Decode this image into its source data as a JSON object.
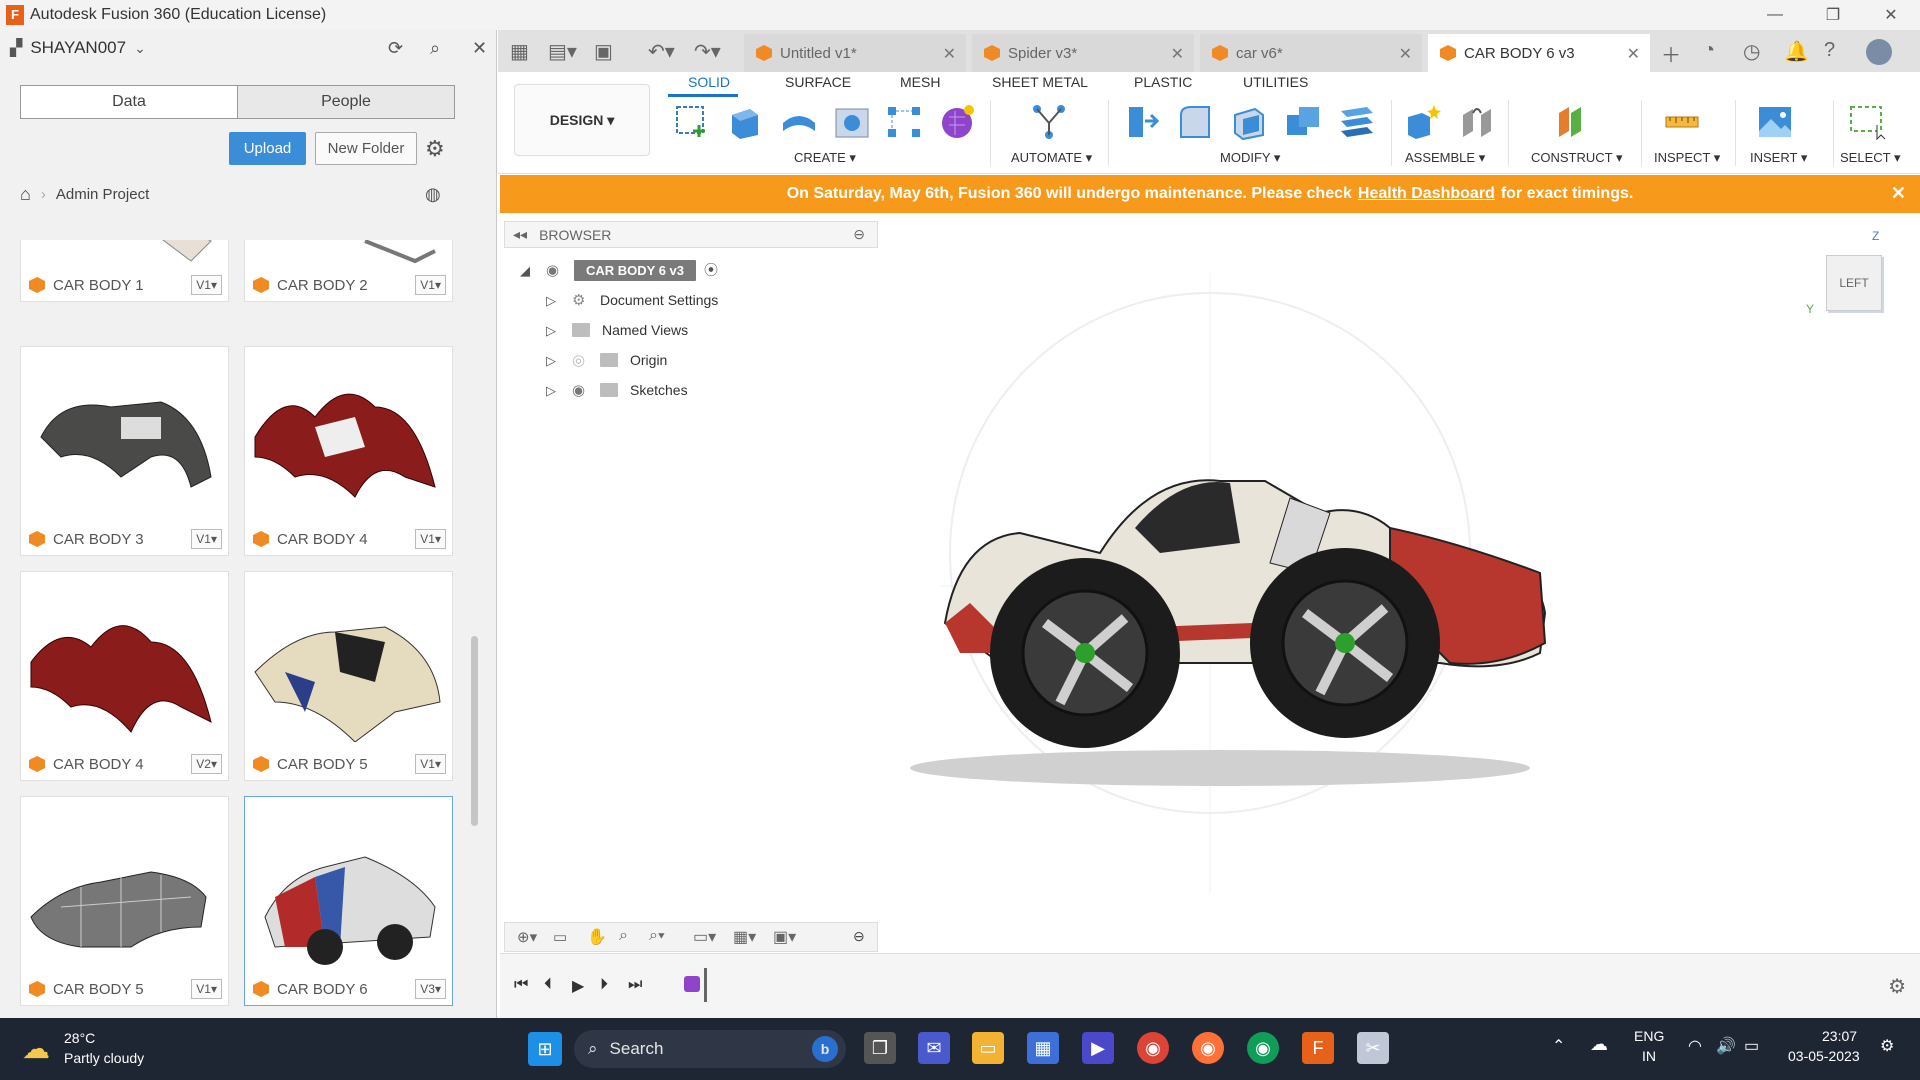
{
  "window": {
    "title": "Autodesk Fusion 360 (Education License)",
    "app_icon": "F"
  },
  "left_panel": {
    "user": "SHAYAN007",
    "tabs": [
      "Data",
      "People"
    ],
    "upload_label": "Upload",
    "new_folder_label": "New Folder",
    "breadcrumb": "Admin Project",
    "cards": [
      {
        "name": "CAR BODY 1",
        "version": "V1▾"
      },
      {
        "name": "CAR BODY 2",
        "version": "V1▾"
      },
      {
        "name": "CAR BODY 3",
        "version": "V1▾"
      },
      {
        "name": "CAR BODY 4",
        "version": "V1▾"
      },
      {
        "name": "CAR BODY 4",
        "version": "V2▾"
      },
      {
        "name": "CAR BODY 5",
        "version": "V1▾"
      },
      {
        "name": "CAR BODY 5",
        "version": "V1▾"
      },
      {
        "name": "CAR BODY 6",
        "version": "V3▾"
      }
    ]
  },
  "doc_tabs": [
    {
      "label": "Untitled v1*"
    },
    {
      "label": "Spider v3*"
    },
    {
      "label": "car v6*"
    },
    {
      "label": "CAR BODY 6 v3",
      "active": true
    }
  ],
  "ribbon": {
    "workspace": "DESIGN ▾",
    "tabs": [
      "SOLID",
      "SURFACE",
      "MESH",
      "SHEET METAL",
      "PLASTIC",
      "UTILITIES"
    ],
    "groups": [
      "CREATE ▾",
      "AUTOMATE ▾",
      "MODIFY ▾",
      "ASSEMBLE ▾",
      "CONSTRUCT ▾",
      "INSPECT ▾",
      "INSERT ▾",
      "SELECT ▾"
    ]
  },
  "banner": {
    "text_before": "On Saturday, May 6th, Fusion 360 will undergo maintenance. Please check",
    "link": "Health Dashboard",
    "text_after": "for exact timings.",
    "close": "✕"
  },
  "browser": {
    "title": "BROWSER",
    "root": "CAR BODY 6 v3",
    "items": [
      "Document Settings",
      "Named Views",
      "Origin",
      "Sketches"
    ]
  },
  "viewcube": {
    "face": "LEFT",
    "axis_z": "Z",
    "axis_y": "Y"
  },
  "taskbar": {
    "weather_temp": "28°C",
    "weather_desc": "Partly cloudy",
    "search_label": "Search",
    "lang_top": "ENG",
    "lang_bottom": "IN",
    "time": "23:07",
    "date": "03-05-2023"
  },
  "colors": {
    "accent": "#1a73c9",
    "banner": "#f79a1c",
    "upload": "#3c8dd7",
    "cube": "#f08a24"
  }
}
